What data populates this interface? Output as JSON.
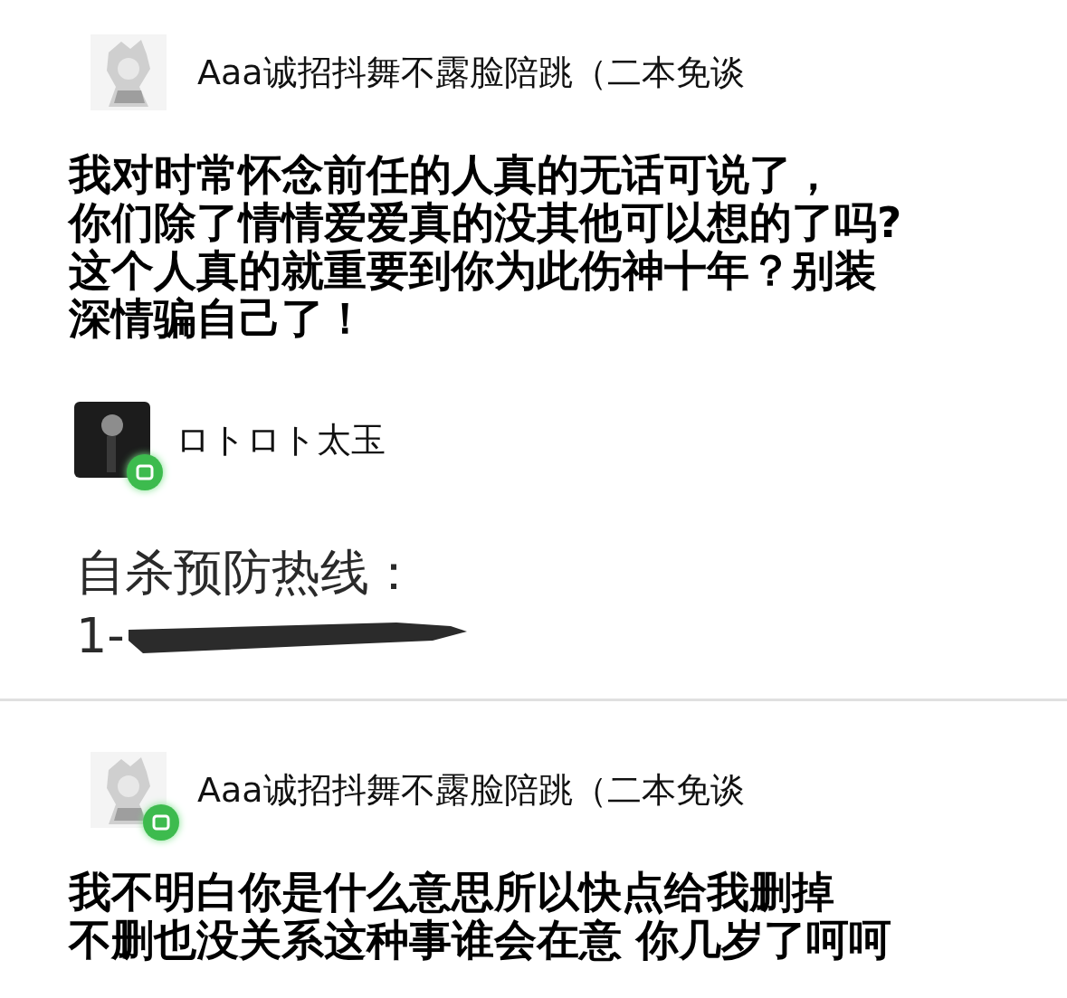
{
  "sections": [
    {
      "posts": [
        {
          "author": "Aaa诚招抖舞不露脸陪跳（二本免谈",
          "avatar": {
            "kind": "sketch",
            "badge": false
          },
          "kind": "comment",
          "lines": [
            "我对时常怀念前任的人真的无话可说了，",
            "你们除了情情爱爱真的没其他可以想的了吗?",
            "这个人真的就重要到你为此伤神十年？别装",
            "深情骗自己了！"
          ],
          "redaction": false
        },
        {
          "author": "ロトロト太玉",
          "avatar": {
            "kind": "dark",
            "badge": true
          },
          "kind": "note",
          "lines": [
            "自杀预防热线：",
            "1-"
          ],
          "redaction": true
        }
      ]
    },
    {
      "posts": [
        {
          "author": "Aaa诚招抖舞不露脸陪跳（二本免谈",
          "avatar": {
            "kind": "sketch",
            "badge": true
          },
          "kind": "comment",
          "lines": [
            "我不明白你是什么意思所以快点给我删掉",
            "不删也没关系这种事谁会在意 你几岁了呵呵"
          ],
          "redaction": false
        }
      ]
    }
  ]
}
